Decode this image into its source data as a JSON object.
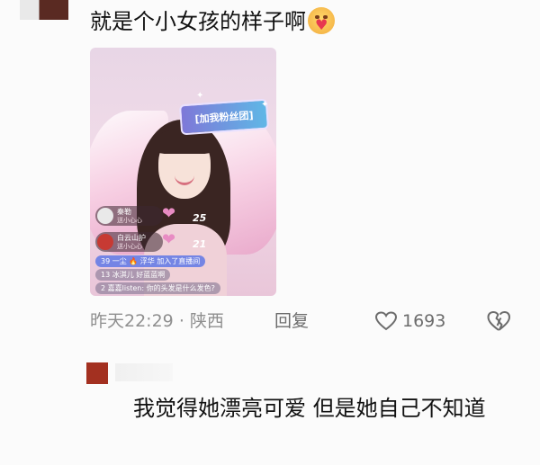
{
  "comment": {
    "text": "就是个小女孩的样子啊",
    "emoji": "smiling-face-with-heart-emoji"
  },
  "screenshot": {
    "crown_text": "[加我粉丝团]",
    "gifts": [
      {
        "name": "秦勒",
        "sub": "送小心心",
        "count": "25"
      },
      {
        "name": "白云山护",
        "sub": "送小心心",
        "count": "21"
      }
    ],
    "chats": [
      "39 一尘 🔥 浮华 加入了直播间",
      "13 冰淇儿 好蓝蓝啊",
      "2 嘉嘉listen: 你的头发是什么发色?"
    ]
  },
  "meta": {
    "time": "昨天22:29",
    "location": "陕西",
    "separator": "·",
    "reply_label": "回复",
    "like_count": "1693"
  },
  "reply": {
    "text": "我觉得她漂亮可爱 但是她自己不知道"
  },
  "colors": {
    "accent_heart": "#e88cc3",
    "meta_gray": "#8f8f8f"
  }
}
